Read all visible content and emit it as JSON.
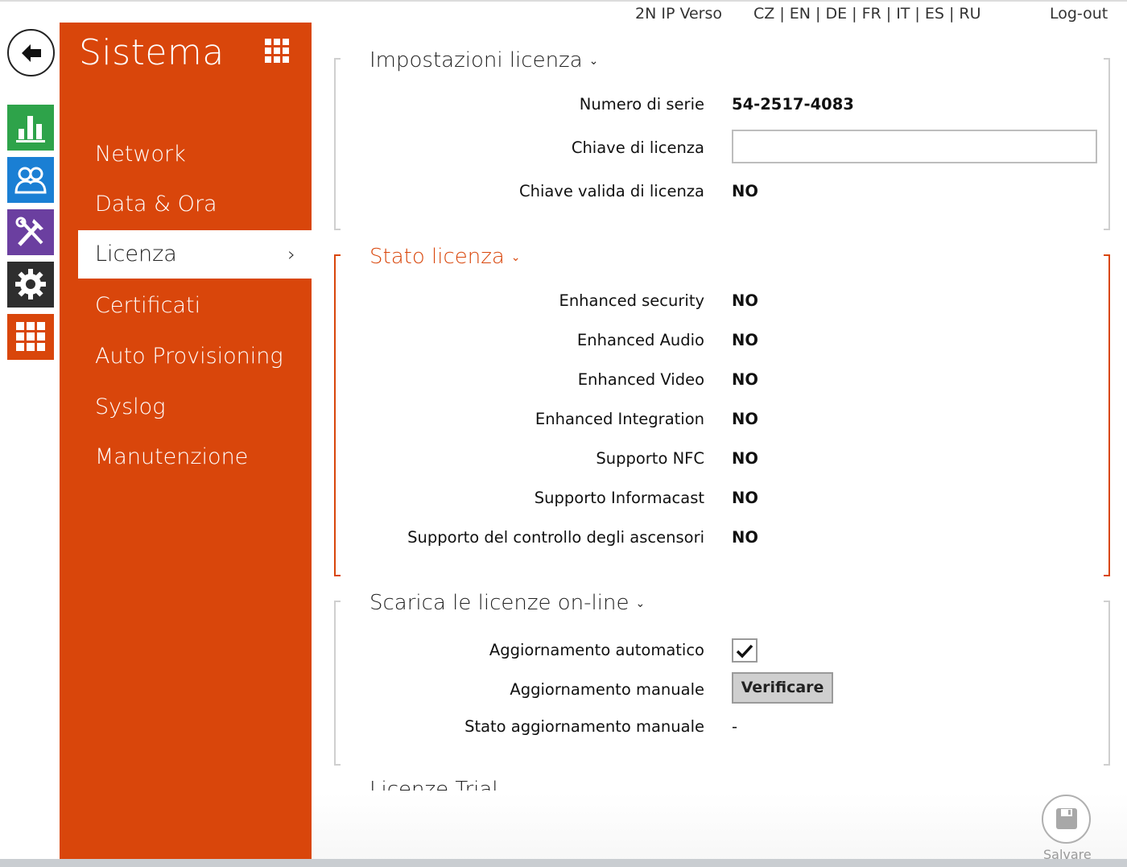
{
  "topbar": {
    "device_name": "2N IP Verso",
    "languages": "CZ | EN | DE | FR | IT | ES | RU",
    "logout": "Log-out"
  },
  "icons": {
    "back": "arrow-left-icon",
    "status": "bar-chart-icon",
    "users": "users-icon",
    "services": "tools-icon",
    "hardware": "gear-icon",
    "system": "grid-icon"
  },
  "menu": {
    "title": "Sistema",
    "items": [
      {
        "label": "Network"
      },
      {
        "label": "Data & Ora"
      },
      {
        "label": "Licenza",
        "active": true
      },
      {
        "label": "Certificati"
      },
      {
        "label": "Auto Provisioning"
      },
      {
        "label": "Syslog"
      },
      {
        "label": "Manutenzione"
      }
    ]
  },
  "license_settings": {
    "title": "Impostazioni licenza",
    "serial_label": "Numero di serie",
    "serial_value": "54-2517-4083",
    "key_label": "Chiave di licenza",
    "key_value": "",
    "valid_label": "Chiave valida di licenza",
    "valid_value": "NO"
  },
  "license_status": {
    "title": "Stato licenza",
    "rows": [
      {
        "label": "Enhanced security",
        "value": "NO"
      },
      {
        "label": "Enhanced Audio",
        "value": "NO"
      },
      {
        "label": "Enhanced Video",
        "value": "NO"
      },
      {
        "label": "Enhanced Integration",
        "value": "NO"
      },
      {
        "label": "Supporto NFC",
        "value": "NO"
      },
      {
        "label": "Supporto Informacast",
        "value": "NO"
      },
      {
        "label": "Supporto del controllo degli ascensori",
        "value": "NO"
      }
    ]
  },
  "online_licenses": {
    "title": "Scarica le licenze on-line",
    "auto_update_label": "Aggiornamento automatico",
    "auto_update_checked": true,
    "manual_update_label": "Aggiornamento manuale",
    "verify_button": "Verificare",
    "manual_status_label": "Stato aggiornamento manuale",
    "manual_status_value": "-"
  },
  "trial": {
    "title": "Licenze Trial"
  },
  "save": {
    "label": "Salvare"
  },
  "colors": {
    "accent": "#d9460b",
    "status": "#2ea34a",
    "users": "#1a7fd4",
    "services": "#6b3fa0",
    "hardware": "#2e2e2e"
  }
}
